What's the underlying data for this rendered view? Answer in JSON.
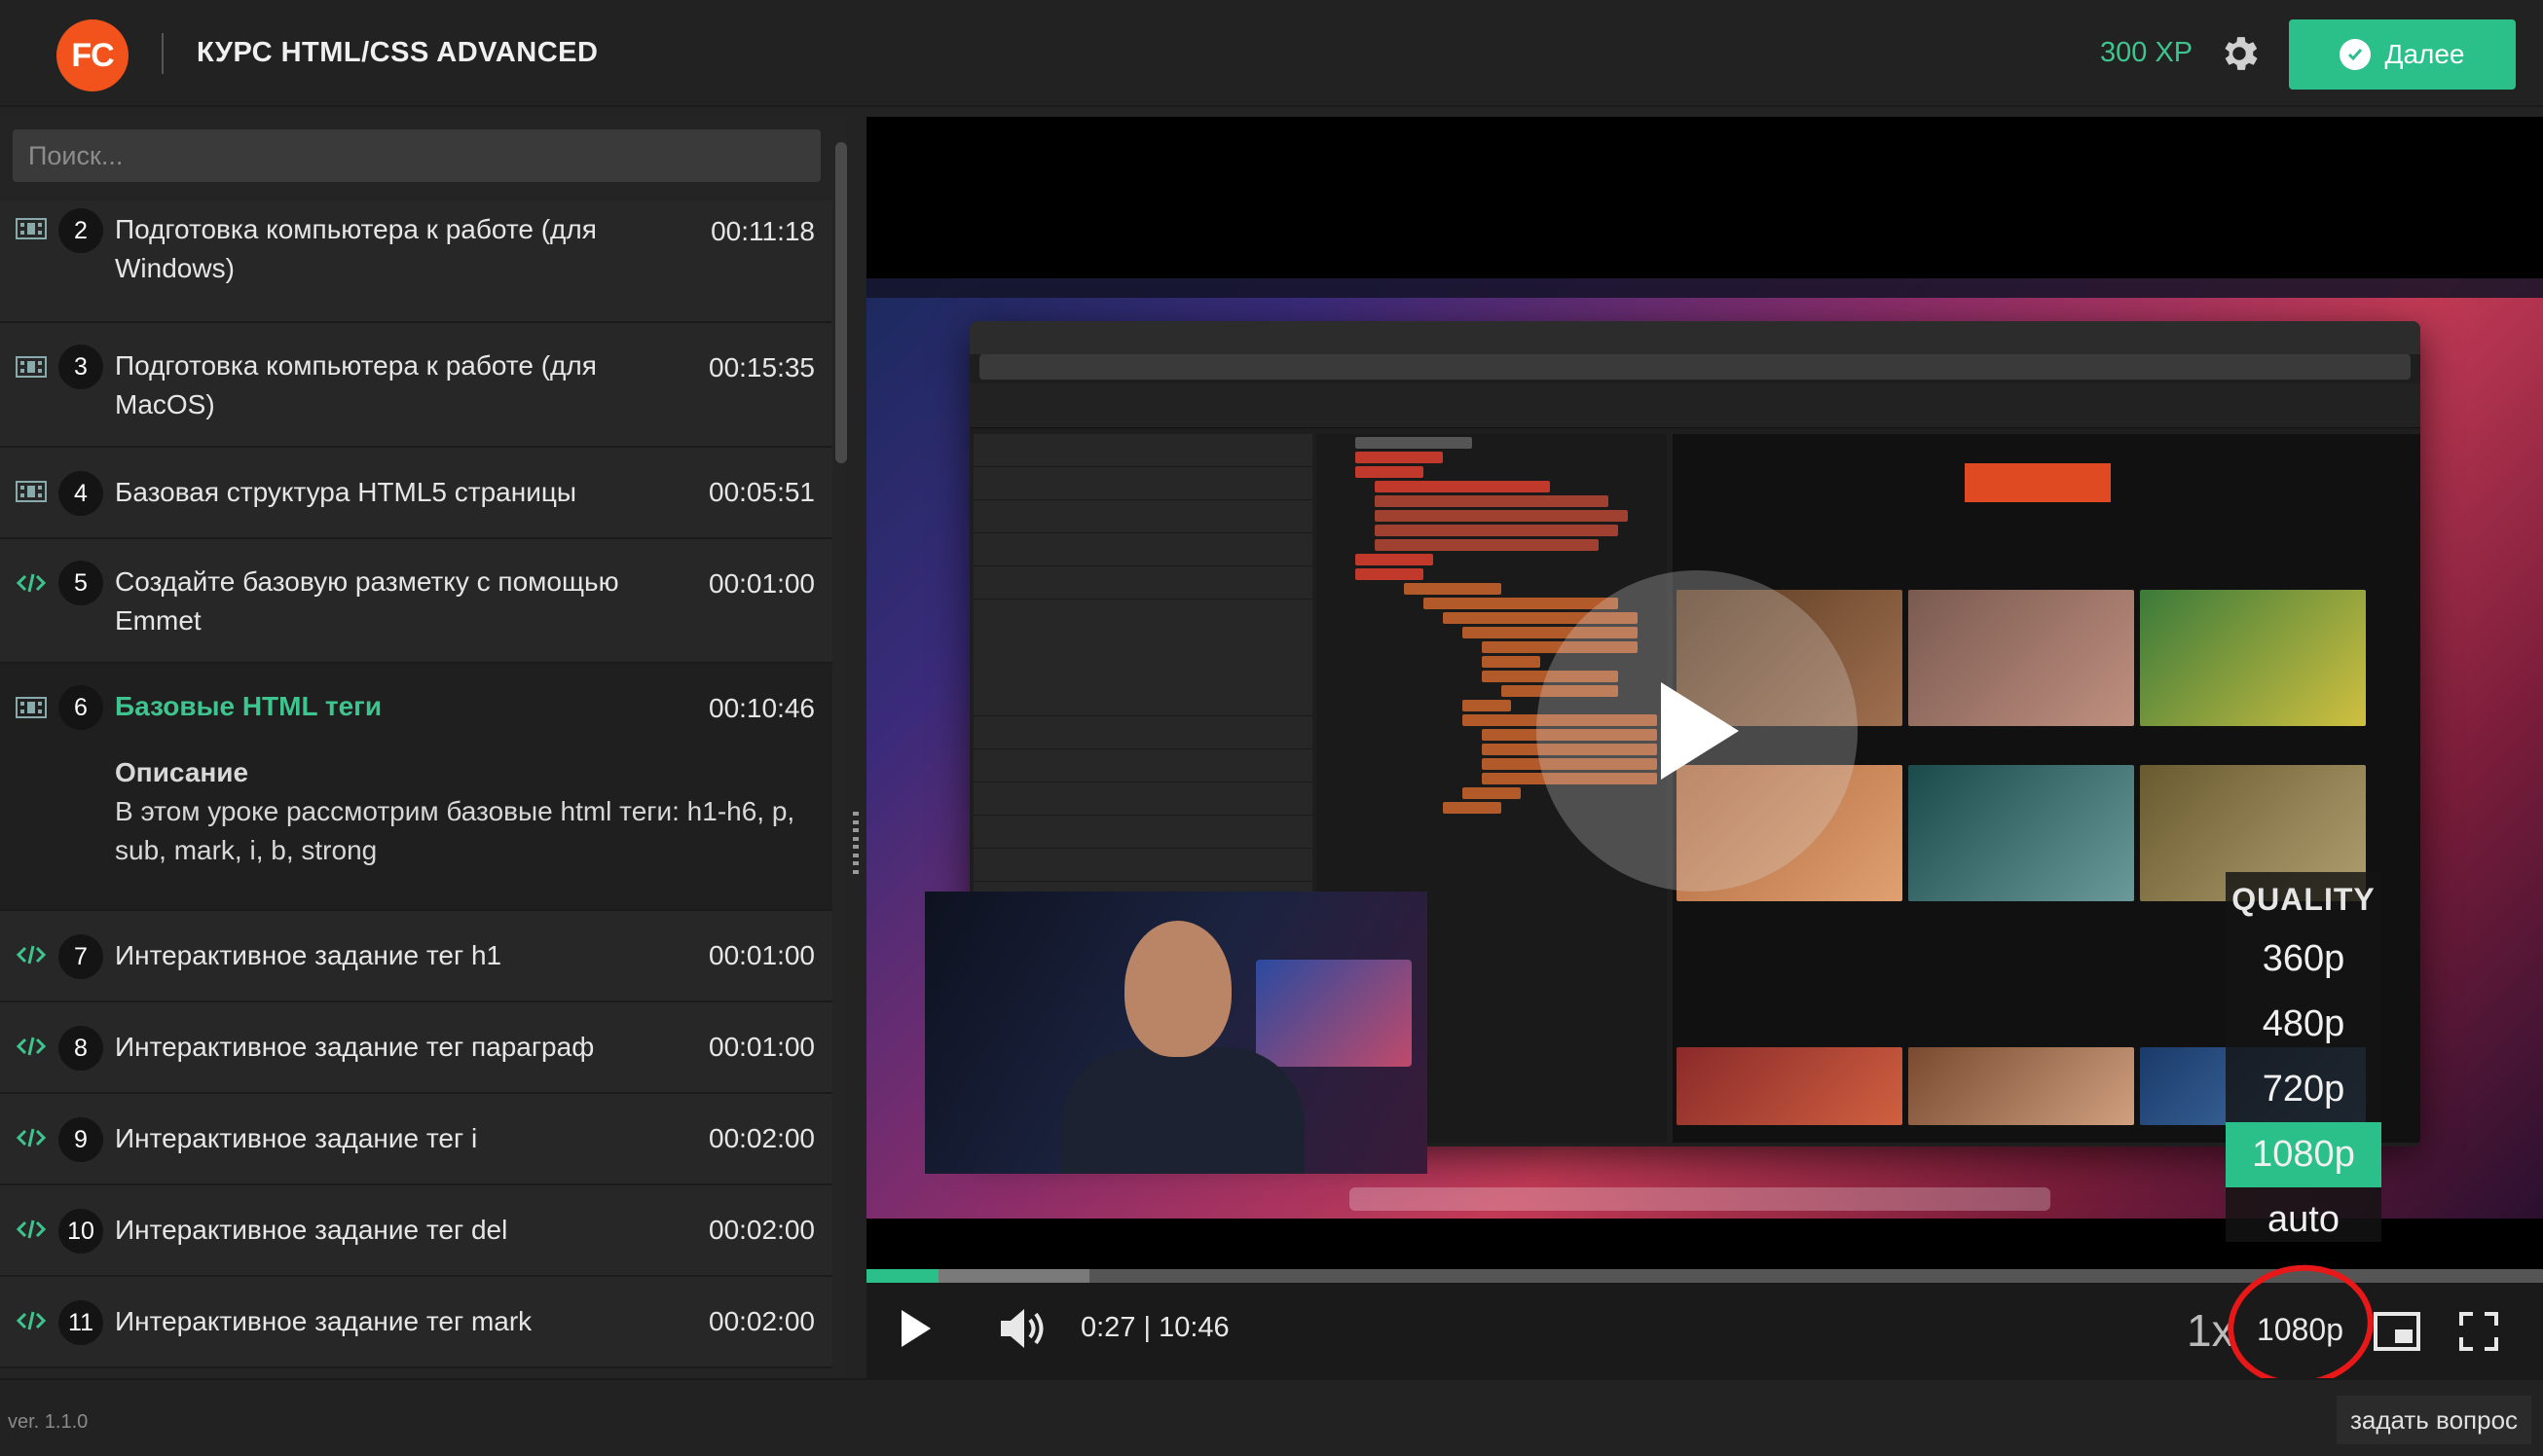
{
  "header": {
    "logo": "FC",
    "course_title": "КУРС HTML/CSS ADVANCED",
    "xp": "300 XP",
    "next_label": "Далее",
    "accent": "#2bbf8a",
    "logo_color": "#f2531c"
  },
  "sidebar": {
    "search_placeholder": "Поиск...",
    "lessons": [
      {
        "num": "2",
        "title": "Подготовка компьютера к работе (для Windows)",
        "time": "00:11:18",
        "icon": "film-icon"
      },
      {
        "num": "3",
        "title": "Подготовка компьютера к работе (для MacOS)",
        "time": "00:15:35",
        "icon": "film-icon"
      },
      {
        "num": "4",
        "title": "Базовая структура HTML5 страницы",
        "time": "00:05:51",
        "icon": "film-icon"
      },
      {
        "num": "5",
        "title": "Создайте базовую разметку с помощью Emmet",
        "time": "00:01:00",
        "icon": "code-icon"
      },
      {
        "num": "6",
        "title": "Базовые HTML теги",
        "time": "00:10:46",
        "icon": "film-icon",
        "active": true,
        "desc_heading": "Описание",
        "desc_text": "В этом уроке рассмотрим базовые html теги: h1-h6, p, sub, mark, i, b, strong"
      },
      {
        "num": "7",
        "title": "Интерактивное задание тег h1",
        "time": "00:01:00",
        "icon": "code-icon"
      },
      {
        "num": "8",
        "title": "Интерактивное задание тег параграф",
        "time": "00:01:00",
        "icon": "code-icon"
      },
      {
        "num": "9",
        "title": "Интерактивное задание тег i",
        "time": "00:02:00",
        "icon": "code-icon"
      },
      {
        "num": "10",
        "title": "Интерактивное задание тег del",
        "time": "00:02:00",
        "icon": "code-icon"
      },
      {
        "num": "11",
        "title": "Интерактивное задание тег mark",
        "time": "00:02:00",
        "icon": "code-icon"
      }
    ]
  },
  "player": {
    "quality_menu": {
      "heading": "QUALITY",
      "options": [
        "360p",
        "480p",
        "720p",
        "1080p",
        "auto"
      ],
      "selected": "1080p"
    },
    "controls": {
      "time": "0:27 | 10:46",
      "rate": "1x",
      "quality": "1080p"
    },
    "progress": {
      "played_fraction": 0.043,
      "buffered_fraction": 0.133
    }
  },
  "footer": {
    "version": "ver. 1.1.0",
    "ask_label": "задать вопрос"
  }
}
